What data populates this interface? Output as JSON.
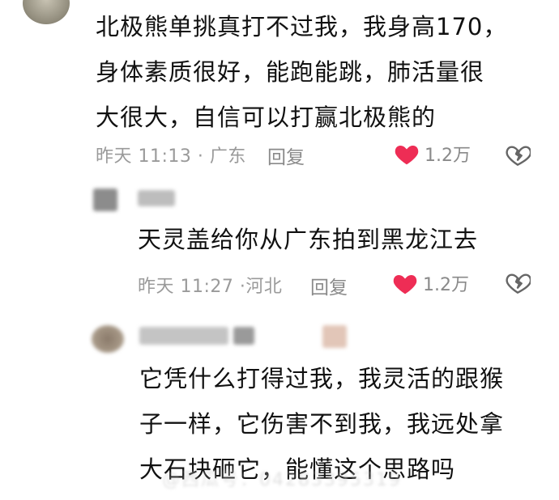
{
  "comments": [
    {
      "text": "北极熊单挑真打不过我，我身高170，\n身体素质很好，能跑能跳，肺活量很\n大很大，自信可以打赢北极熊的",
      "time": "昨天",
      "clock": "11:13",
      "location": "· 广东",
      "reply": "回复",
      "likes": "1.2万"
    },
    {
      "text": "天灵盖给你从广东拍到黑龙江去",
      "time": "昨天",
      "clock": "11:27",
      "location": "·河北",
      "reply": "回复",
      "likes": "1.2万"
    },
    {
      "text": "它凭什么打得过我，我灵活的跟猴\n子一样，它伤害不到我，我远处拿\n大石块砸它，能懂这个思路吗"
    }
  ],
  "watermark": "@西瓜号：04283395319",
  "colors": {
    "heart": "#ee2d55",
    "meta": "#9a9a9a",
    "text": "#111111"
  },
  "icons": [
    "heart-icon",
    "broken-heart-icon"
  ]
}
